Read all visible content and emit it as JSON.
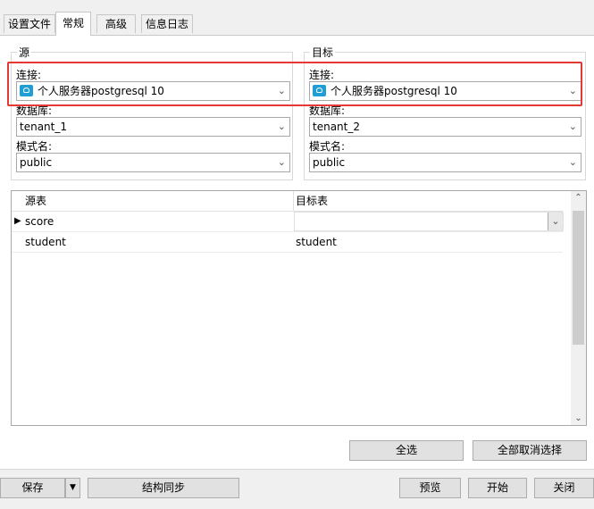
{
  "tabs": [
    {
      "label": "设置文件"
    },
    {
      "label": "常规"
    },
    {
      "label": "高级"
    },
    {
      "label": "信息日志"
    }
  ],
  "source": {
    "title": "源",
    "connection_label": "连接:",
    "connection_value": "个人服务器postgresql 10",
    "database_label": "数据库:",
    "database_value": "tenant_1",
    "schema_label": "模式名:",
    "schema_value": "public"
  },
  "target": {
    "title": "目标",
    "connection_label": "连接:",
    "connection_value": "个人服务器postgresql 10",
    "database_label": "数据库:",
    "database_value": "tenant_2",
    "schema_label": "模式名:",
    "schema_value": "public"
  },
  "table_map": {
    "headers": [
      "源表",
      "目标表"
    ],
    "rows": [
      {
        "source": "score",
        "target": ""
      },
      {
        "source": "student",
        "target": "student"
      }
    ]
  },
  "buttons": {
    "select_all": "全选",
    "deselect_all": "全部取消选择",
    "save": "保存",
    "structure_sync": "结构同步",
    "preview": "预览",
    "start": "开始",
    "close": "关闭"
  },
  "icons": {
    "connection": "postgresql-elephant-icon",
    "dropdown": "chevron-down-icon"
  }
}
